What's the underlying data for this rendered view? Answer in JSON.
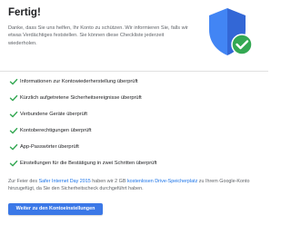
{
  "header": {
    "title": "Fertig!",
    "intro": "Danke, dass Sie uns helfen, Ihr Konto zu schützen. Wir informieren Sie, falls wir etwas Verdächtiges feststellen. Sie können diese Checkliste jederzeit wiederholen."
  },
  "shield": {
    "icon": "shield-check-icon",
    "shield_color": "#4285f4",
    "shield_dark_color": "#3367d6",
    "check_color": "#34a853"
  },
  "checklist": {
    "check_color": "#34a853",
    "items": [
      {
        "label": "Informationen zur Kontowiederherstellung überprüft"
      },
      {
        "label": "Kürzlich aufgetretene Sicherheitsereignisse überprüft"
      },
      {
        "label": "Verbundene Geräte überprüft"
      },
      {
        "label": "Kontoberechtigungen überprüft"
      },
      {
        "label": "App-Passwörter überprüft"
      },
      {
        "label": "Einstellungen für die Bestätigung in zwei Schritten überprüft"
      }
    ]
  },
  "footer": {
    "text_1": "Zur Feier des ",
    "link_1": "Safer Internet Day 2015",
    "text_2": " haben wir 2 GB ",
    "link_2": "kostenlosen Drive-Speicherplatz",
    "text_3": " zu Ihrem Google-Konto hinzugefügt, da Sie den Sicherheitscheck durchgeführt haben.",
    "link_color": "#1a73e8"
  },
  "actions": {
    "primary_label": "Weiter zu den Kontoeinstellungen",
    "primary_color": "#3b78e7"
  }
}
